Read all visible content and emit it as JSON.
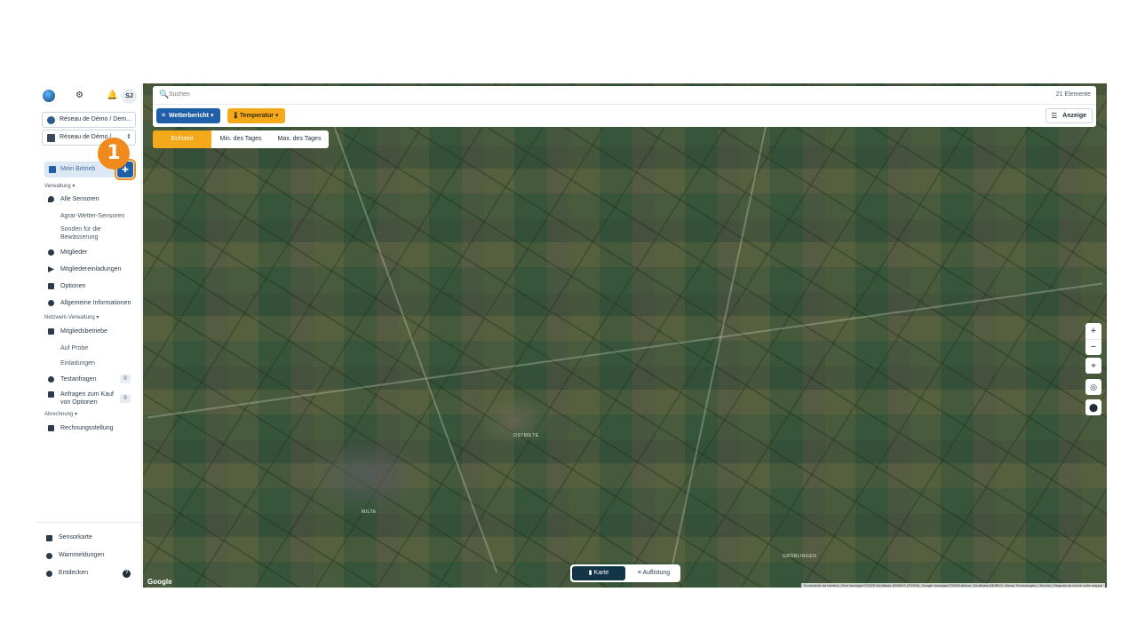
{
  "header": {
    "avatar_initials": "SJ"
  },
  "network_selects": [
    "Réseau de Démo / Dem...",
    "Réseau de Démo / ..."
  ],
  "sidebar": {
    "mein_betrieb": "Mein Betrieb",
    "step_number": "1",
    "verwaltung": "Verwaltung",
    "items": {
      "alle_sensoren": "Alle Sensoren",
      "agrar_wetter": "Agrar-Wetter-Sensoren",
      "sonden": "Sonden für die Bewässerung",
      "mitglieder": "Mitglieder",
      "mitgliedereinladungen": "Mitgliedereinladungen",
      "optionen": "Optionen",
      "allgemeine": "Allgemeine Informationen"
    },
    "netzwerk_verwaltung": "Netzwerk-Verwaltung",
    "netzwerk_items": {
      "mitgliedsbetriebe": "Mitgliedsbetriebe",
      "auf_probe": "Auf Probe",
      "einladungen": "Einladungen",
      "testanfragen": "Testanfragen",
      "testanfragen_count": "0",
      "anfragen_kauf": "Anfragen zum Kauf von Optionen",
      "anfragen_kauf_count": "0"
    },
    "abrechnung": "Abrechnung",
    "rechnungsstellung": "Rechnungsstellung",
    "bottom": {
      "sensorkarte": "Sensorkarte",
      "warnmeldungen": "Warnmeldungen",
      "entdecken": "Entdecken"
    }
  },
  "map": {
    "search_placeholder": "Suchen",
    "count": "21 Elemente",
    "dropdown_weather": "Wetterbericht",
    "dropdown_temp": "Temperatur",
    "anzeige": "Anzeige",
    "segments": [
      "Echtzeit",
      "Min. des Tages",
      "Max. des Tages"
    ],
    "view_map": "Karte",
    "view_list": "Auflistung",
    "labels": {
      "ostmilte": "OSTMILTE",
      "milte": "MILTE",
      "grobingen": "GRÖBLINGEN"
    },
    "google": "Google",
    "attribution": "Scorciatoie da tastiera | Dati immagini ©2025 GeoBasis-DE/BKG (©2009), Google Immagini ©2025 Airbus, GeoBasis-DE/BKG, Maxar Technologies | Termini | Segnala un errore nella mappa"
  }
}
